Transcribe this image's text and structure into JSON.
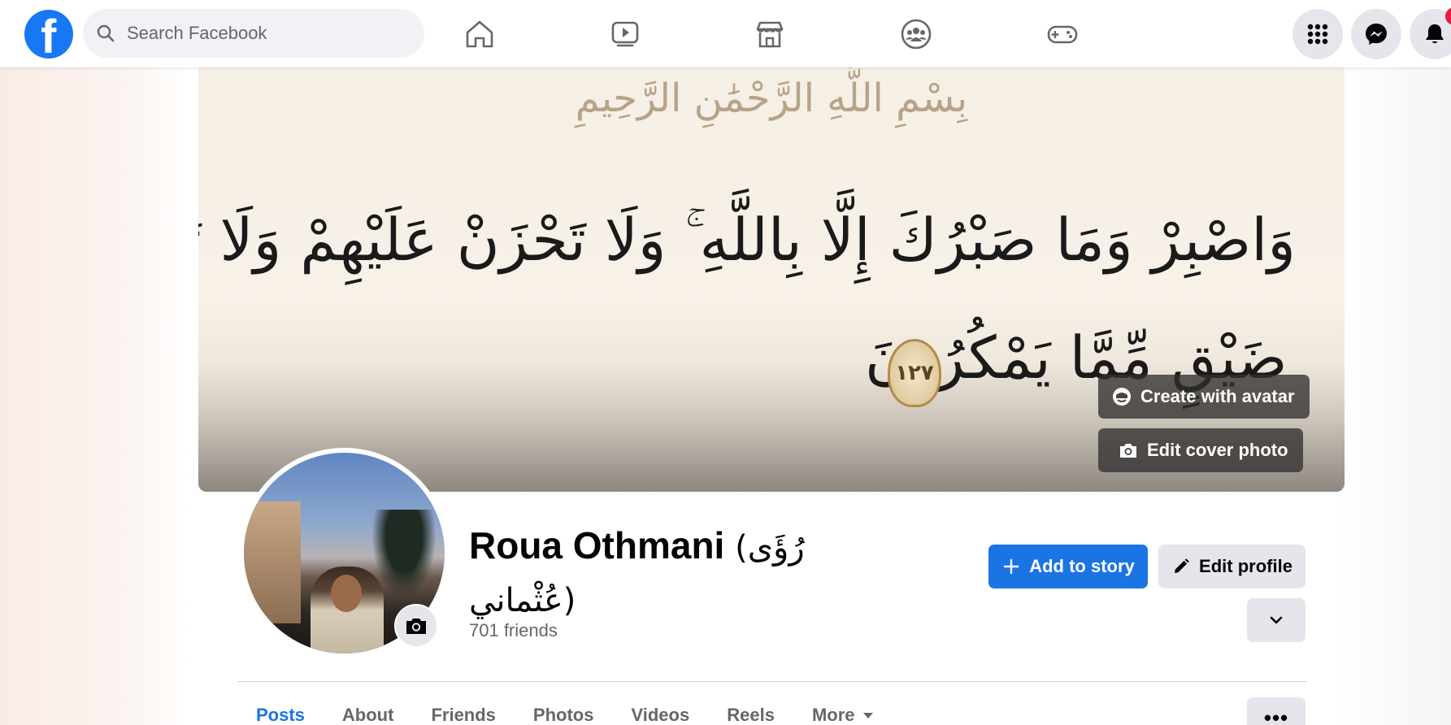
{
  "topbar": {
    "logo_letter": "f",
    "search_placeholder": "Search Facebook",
    "nav_icons": [
      "home-icon",
      "video-icon",
      "marketplace-icon",
      "groups-icon",
      "gaming-icon"
    ],
    "right_icons": [
      "menu-grid-icon",
      "messenger-icon",
      "bell-icon"
    ],
    "accent_color": "#1877f2",
    "notification_color": "#e41e3f"
  },
  "cover": {
    "bismillah": "بِسْمِ اللَّهِ الرَّحْمَٰنِ الرَّحِيمِ",
    "verse_line1": "وَاصْبِرْ وَمَا صَبْرُكَ إِلَّا بِاللَّهِ ۚ وَلَا تَحْزَنْ عَلَيْهِمْ وَلَا تَكُ فِي",
    "verse_line2": "ضَيْقٍ مِّمَّا يَمْكُرُونَ",
    "ayah_number": "١٢٧",
    "create_avatar_label": "Create with avatar",
    "edit_cover_label": "Edit cover photo"
  },
  "profile": {
    "name_latin": "Roua Othmani",
    "name_arabic": "(رُؤَى عُثْماني)",
    "friends": "701 friends",
    "add_story_label": "Add to story",
    "edit_profile_label": "Edit profile"
  },
  "tabs": {
    "items": [
      "Posts",
      "About",
      "Friends",
      "Photos",
      "Videos",
      "Reels",
      "More"
    ],
    "active": "Posts",
    "more_dots": "•••"
  }
}
